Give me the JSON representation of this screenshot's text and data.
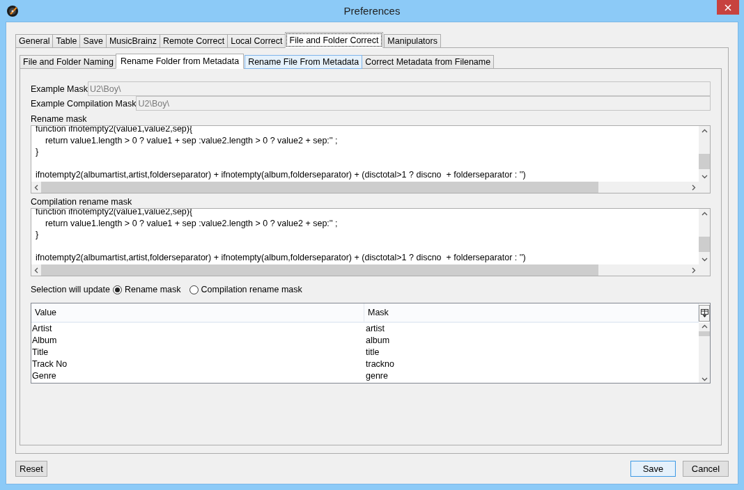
{
  "window": {
    "title": "Preferences"
  },
  "tabs": [
    {
      "label": "General",
      "selected": false
    },
    {
      "label": "Table",
      "selected": false
    },
    {
      "label": "Save",
      "selected": false
    },
    {
      "label": "MusicBrainz",
      "selected": false
    },
    {
      "label": "Remote Correct",
      "selected": false
    },
    {
      "label": "Local Correct",
      "selected": false
    },
    {
      "label": "File and Folder Correct",
      "selected": true
    },
    {
      "label": "Manipulators",
      "selected": false
    }
  ],
  "subtabs": [
    {
      "label": "File and Folder Naming",
      "selected": false,
      "hovered": false
    },
    {
      "label": "Rename Folder from Metadata",
      "selected": true,
      "hovered": false
    },
    {
      "label": "Rename File From Metadata",
      "selected": false,
      "hovered": true
    },
    {
      "label": "Correct Metadata from Filename",
      "selected": false,
      "hovered": false
    }
  ],
  "example_fields": [
    {
      "label": "Example Mask",
      "value": "U2\\Boy\\",
      "disabled": true
    },
    {
      "label": "Example Compilation Mask",
      "value": "U2\\Boy\\",
      "disabled": true
    }
  ],
  "masks": [
    {
      "label": "Rename mask",
      "lines": [
        {
          "text": "function ifnotempty2(value1,value2,sep){",
          "blank_before": false
        },
        {
          "text": "    return value1.length > 0 ? value1 + sep :value2.length > 0 ? value2 + sep:'' ;",
          "blank_before": false
        },
        {
          "text": "}",
          "blank_before": false
        },
        {
          "text": "ifnotempty2(albumartist,artist,folderseparator) + ifnotempty(album,folderseparator) + (disctotal>1 ? discno  + folderseparator : '')",
          "blank_before": true
        }
      ]
    },
    {
      "label": "Compilation rename mask",
      "lines": [
        {
          "text": "function ifnotempty2(value1,value2,sep){",
          "blank_before": false
        },
        {
          "text": "    return value1.length > 0 ? value1 + sep :value2.length > 0 ? value2 + sep:'' ;",
          "blank_before": false
        },
        {
          "text": "}",
          "blank_before": false
        },
        {
          "text": "ifnotempty2(albumartist,artist,folderseparator) + ifnotempty(album,folderseparator) + (disctotal>1 ? discno  + folderseparator : '')",
          "blank_before": true
        }
      ]
    }
  ],
  "selection": {
    "label": "Selection will update",
    "options": [
      {
        "label": "Rename mask",
        "selected": true
      },
      {
        "label": "Compilation rename mask",
        "selected": false
      }
    ]
  },
  "table": {
    "columns": [
      "Value",
      "Mask"
    ],
    "rows": [
      [
        "Artist",
        "artist"
      ],
      [
        "Album",
        "album"
      ],
      [
        "Title",
        "title"
      ],
      [
        "Track No",
        "trackno"
      ],
      [
        "Genre",
        "genre"
      ]
    ]
  },
  "buttons": [
    {
      "label": "Reset",
      "kind": "reset"
    },
    {
      "label": "Save",
      "kind": "default"
    },
    {
      "label": "Cancel",
      "kind": "normal"
    }
  ]
}
